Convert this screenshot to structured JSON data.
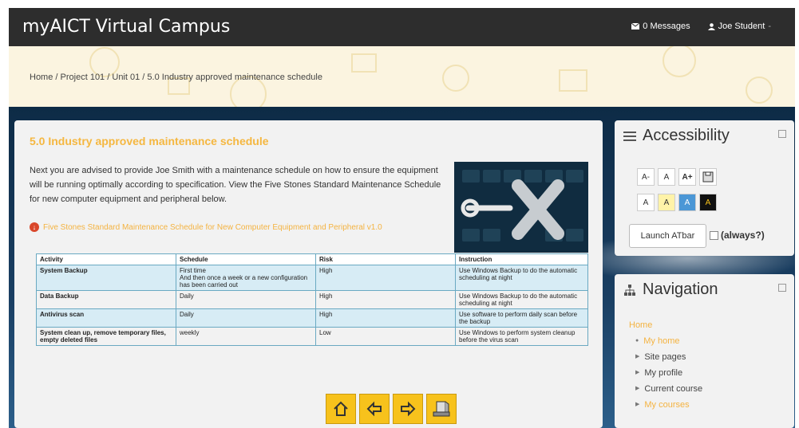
{
  "topbar": {
    "brand": "myAICT Virtual Campus",
    "messages": "0 Messages",
    "user": "Joe Student",
    "user_caret": "-"
  },
  "breadcrumb": [
    "Home",
    "Project 101",
    "Unit 01",
    "5.0 Industry approved maintenance schedule"
  ],
  "breadcrumb_separator": "/",
  "main": {
    "title": "5.0 Industry approved maintenance schedule",
    "intro": "Next you are advised to provide Joe Smith with a maintenance schedule on how to ensure the equipment will be running optimally according to specification. View the Five Stones Standard Maintenance Schedule for new computer equipment and peripheral below.",
    "link": "Five Stones Standard Maintenance Schedule for New Computer Equipment and Peripheral v1.0",
    "table": {
      "headers": [
        "Activity",
        "Schedule",
        "Risk",
        "Instruction"
      ],
      "rows": [
        [
          "System Backup",
          "First time\nAnd then once a week or a new configuration has been carried out",
          "High",
          "Use Windows Backup to do the automatic scheduling at night"
        ],
        [
          "Data Backup",
          "Daily",
          "High",
          "Use Windows Backup to do the automatic scheduling at night"
        ],
        [
          "Antivirus scan",
          "Daily",
          "High",
          "Use software to perform daily scan before the backup"
        ],
        [
          "System clean up, remove temporary files, empty deleted files",
          "weekly",
          "Low",
          "Use Windows to perform system cleanup before the virus scan"
        ]
      ]
    },
    "nav_buttons": [
      "home-icon",
      "back-arrow-icon",
      "forward-arrow-icon",
      "exit-icon"
    ]
  },
  "accessibility": {
    "title": "Accessibility",
    "font_buttons": [
      "A-",
      "A",
      "A+"
    ],
    "color_buttons": [
      "A",
      "A",
      "A",
      "A"
    ],
    "launch_label": "Launch ATbar",
    "always_label": "(always?)"
  },
  "navigation": {
    "title": "Navigation",
    "home": "Home",
    "items": [
      "My home",
      "Site pages",
      "My profile",
      "Current course",
      "My courses"
    ]
  },
  "colors": {
    "accent": "#f4b341",
    "topbar": "#2d2d2d",
    "button_yellow": "#f7c21c",
    "table_alt": "#d7ecf5"
  }
}
